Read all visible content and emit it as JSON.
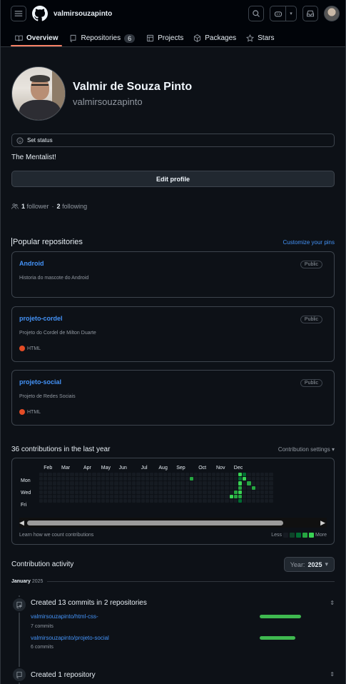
{
  "header": {
    "username": "valmirsouzapinto"
  },
  "tabs": [
    {
      "label": "Overview",
      "icon": "book-icon",
      "active": true
    },
    {
      "label": "Repositories",
      "icon": "repo-icon",
      "count": "6"
    },
    {
      "label": "Projects",
      "icon": "table-icon"
    },
    {
      "label": "Packages",
      "icon": "package-icon"
    },
    {
      "label": "Stars",
      "icon": "star-icon"
    }
  ],
  "profile": {
    "name": "Valmir de Souza Pinto",
    "login": "valmirsouzapinto",
    "set_status": "Set status",
    "bio": "The Mentalist!",
    "edit_profile": "Edit profile",
    "followers_count": "1",
    "followers_label": "follower",
    "separator": "·",
    "following_count": "2",
    "following_label": "following"
  },
  "popular": {
    "title": "Popular repositories",
    "customize": "Customize your pins",
    "repos": [
      {
        "name": "Android",
        "visibility": "Public",
        "description": "Historia do mascote do Android",
        "language": ""
      },
      {
        "name": "projeto-cordel",
        "visibility": "Public",
        "description": "Projeto do Cordel de Milton Duarte",
        "language": "HTML",
        "language_color": "#e34c26"
      },
      {
        "name": "projeto-social",
        "visibility": "Public",
        "description": "Projeto de Redes Sociais",
        "language": "HTML",
        "language_color": "#e34c26"
      }
    ]
  },
  "contributions": {
    "title": "36 contributions in the last year",
    "settings": "Contribution settings",
    "months": [
      "Feb",
      "Mar",
      "Apr",
      "May",
      "Jun",
      "Jul",
      "Aug",
      "Sep",
      "Oct",
      "Nov",
      "Dec"
    ],
    "days": [
      "Mon",
      "Wed",
      "Fri"
    ],
    "learn": "Learn how we count contributions",
    "less": "Less",
    "more": "More",
    "level_colors": [
      "#161b22",
      "#0e4429",
      "#006d32",
      "#26a641",
      "#39d353"
    ],
    "active_cells": [
      {
        "week": 34,
        "day": 1,
        "level": 3
      },
      {
        "week": 43,
        "day": 5,
        "level": 4
      },
      {
        "week": 44,
        "day": 4,
        "level": 3
      },
      {
        "week": 44,
        "day": 5,
        "level": 3
      },
      {
        "week": 45,
        "day": 0,
        "level": 4
      },
      {
        "week": 45,
        "day": 1,
        "level": 2
      },
      {
        "week": 45,
        "day": 2,
        "level": 4
      },
      {
        "week": 45,
        "day": 3,
        "level": 3
      },
      {
        "week": 45,
        "day": 4,
        "level": 4
      },
      {
        "week": 45,
        "day": 5,
        "level": 3
      },
      {
        "week": 45,
        "day": 6,
        "level": 2
      },
      {
        "week": 46,
        "day": 0,
        "level": 2
      },
      {
        "week": 46,
        "day": 1,
        "level": 4
      },
      {
        "week": 47,
        "day": 2,
        "level": 3
      },
      {
        "week": 48,
        "day": 3,
        "level": 3
      }
    ]
  },
  "activity": {
    "title": "Contribution activity",
    "year_label": "Year:",
    "year_value": "2025",
    "month": "January",
    "month_year": "2025",
    "event1": {
      "title": "Created 13 commits in 2 repositories",
      "repos": [
        {
          "name": "valmirsouzapinto/html-css-",
          "commits": "7 commits",
          "fraction": 0.54
        },
        {
          "name": "valmirsouzapinto/projeto-social",
          "commits": "6 commits",
          "fraction": 0.46
        }
      ]
    },
    "event2": {
      "title": "Created 1 repository"
    }
  }
}
